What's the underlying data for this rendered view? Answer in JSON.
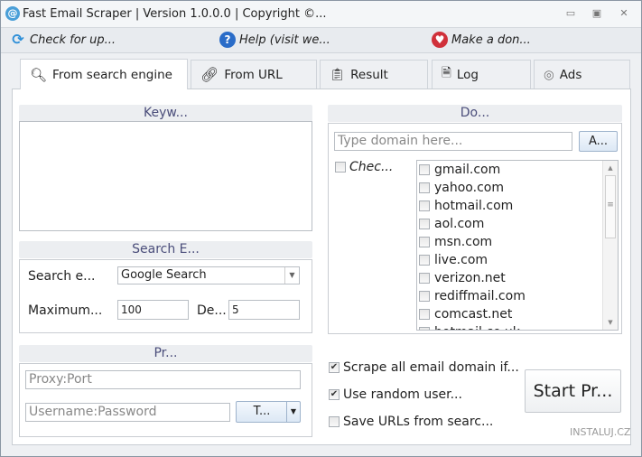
{
  "window": {
    "title": "Fast Email Scraper | Version 1.0.0.0 | Copyright ©...",
    "app_icon": "at-sign-icon"
  },
  "toolbar": {
    "check_updates": "Check for up...",
    "help": "Help (visit we...",
    "donate": "Make a don..."
  },
  "tabs": [
    {
      "label": "From search engine",
      "icon": "magnifier-icon"
    },
    {
      "label": "From URL",
      "icon": "link-icon"
    },
    {
      "label": "Result",
      "icon": "clipboard-check-icon"
    },
    {
      "label": "Log",
      "icon": "log-file-icon"
    },
    {
      "label": "Ads",
      "icon": "cursor-target-icon"
    }
  ],
  "keywords": {
    "header": "Keyw...",
    "value": ""
  },
  "search_engine": {
    "header": "Search E...",
    "engine_label": "Search e...",
    "engine_value": "Google Search",
    "max_label": "Maximum...",
    "max_value": "100",
    "delay_label": "De...",
    "delay_value": "5"
  },
  "proxy": {
    "header": "Pr...",
    "proxy_placeholder": "Proxy:Port",
    "auth_placeholder": "Username:Password",
    "type_button": "T..."
  },
  "domains": {
    "header": "Do...",
    "input_placeholder": "Type domain here...",
    "add_button": "A...",
    "check_all": "Chec...",
    "items": [
      "gmail.com",
      "yahoo.com",
      "hotmail.com",
      "aol.com",
      "msn.com",
      "live.com",
      "verizon.net",
      "rediffmail.com",
      "comcast.net",
      "hotmail.co.uk"
    ]
  },
  "options": [
    {
      "label": "Scrape all email domain if...",
      "checked": true
    },
    {
      "label": "Use random user...",
      "checked": true
    },
    {
      "label": "Save URLs from searc...",
      "checked": false
    }
  ],
  "start_button": "Start Pr...",
  "watermark": "INSTALUJ.CZ"
}
